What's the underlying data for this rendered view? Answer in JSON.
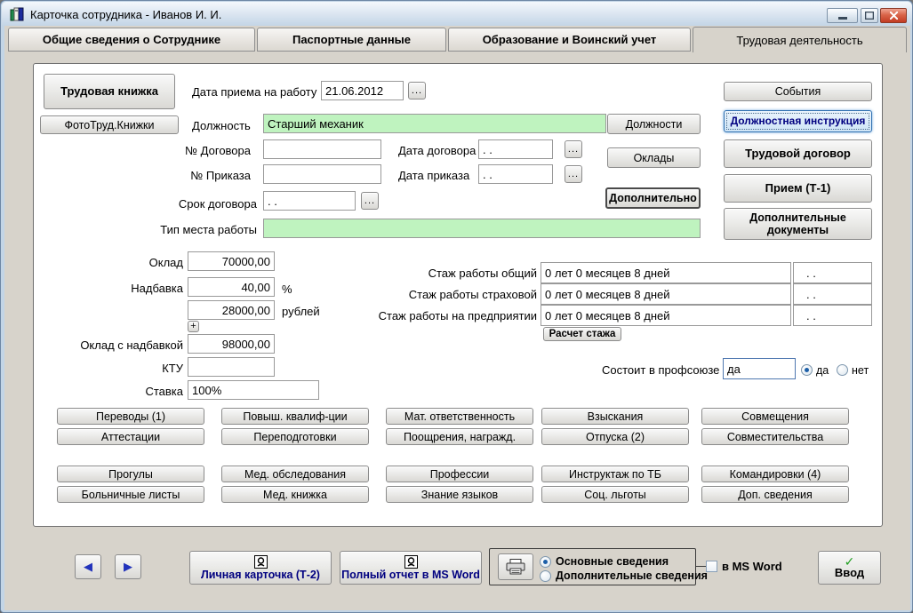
{
  "window": {
    "title": "Карточка сотрудника -  Иванов И. И."
  },
  "tabs": {
    "items": [
      {
        "label": "Общие сведения о Сотруднике"
      },
      {
        "label": "Паспортные данные"
      },
      {
        "label": "Образование и Воинский учет"
      },
      {
        "label": "Трудовая деятельность"
      }
    ],
    "active": "Трудовая деятельность"
  },
  "ui": {
    "browse_label": "...",
    "plus": "+",
    "prev": "◀",
    "next": "▶",
    "enter_check": "✓"
  },
  "left_buttons": {
    "labor_book": "Трудовая книжка",
    "photo_labor_book": "ФотоТруд.Книжки"
  },
  "fields": {
    "hire_date": {
      "label": "Дата приема на работу",
      "value": "21.06.2012"
    },
    "position": {
      "label": "Должность",
      "value": "Старший механик"
    },
    "contract_no": {
      "label": "№ Договора",
      "value": ""
    },
    "contract_date": {
      "label": "Дата договора",
      "value": ". ."
    },
    "order_no": {
      "label": "№ Приказа",
      "value": ""
    },
    "order_date": {
      "label": "Дата приказа",
      "value": ". ."
    },
    "contract_term": {
      "label": "Срок договора",
      "value": ". ."
    },
    "workplace_type": {
      "label": "Тип места работы",
      "value": ""
    }
  },
  "mid_buttons": {
    "positions": "Должности",
    "salaries": "Оклады",
    "additional": "Дополнительно"
  },
  "right_buttons": {
    "events": "События",
    "job_instruction": "Должностная инструкция",
    "labor_contract": "Трудовой  договор",
    "hiring_t1": "Прием (Т-1)",
    "additional_documents": "Дополнительные документы"
  },
  "salary": {
    "salary": {
      "label": "Оклад",
      "value": "70000,00"
    },
    "bonus_percent": {
      "label": "Надбавка",
      "value": "40,00",
      "unit": "%"
    },
    "bonus_rub": {
      "value": "28000,00",
      "unit": "рублей"
    },
    "salary_with_bonus": {
      "label": "Оклад с надбавкой",
      "value": "98000,00"
    },
    "ktu": {
      "label": "КТУ",
      "value": ""
    },
    "rate": {
      "label": "Ставка",
      "value": "100%"
    }
  },
  "experience": {
    "rows": [
      {
        "label": "Стаж работы общий",
        "value": "0 лет 0 месяцев 8 дней",
        "date": ". ."
      },
      {
        "label": "Стаж работы страховой",
        "value": "0 лет 0 месяцев 8 дней",
        "date": ". ."
      },
      {
        "label": "Стаж работы на предприятии",
        "value": "0 лет 0 месяцев 8 дней",
        "date": ". ."
      }
    ],
    "calc_button": "Расчет стажа"
  },
  "union": {
    "label": "Состоит в профсоюзе",
    "value": "да",
    "yes": "да",
    "no": "нет",
    "selected": "да"
  },
  "grid": {
    "rows": [
      [
        "Переводы (1)",
        "Повыш. квалиф-ции",
        "Мат. ответственность",
        "Взыскания",
        "Совмещения"
      ],
      [
        "Аттестации",
        "Переподготовки",
        "Поощрения, награжд.",
        "Отпуска (2)",
        "Совместительства"
      ],
      [
        "Прогулы",
        "Мед. обследования",
        "Профессии",
        "Инструктаж по ТБ",
        "Командировки (4)"
      ],
      [
        "Больничные листы",
        "Мед. книжка",
        "Знание языков",
        "Соц. льготы",
        "Доп. сведения"
      ]
    ]
  },
  "footer": {
    "personal_card": "Личная карточка (Т-2)",
    "full_report": "Полный отчет в MS Word",
    "print_options": {
      "main": "Основные сведения",
      "additional": "Дополнительные сведения",
      "selected": "Основные сведения"
    },
    "word_checkbox": {
      "label": "в MS Word",
      "checked": false
    },
    "enter_button": "Ввод"
  }
}
